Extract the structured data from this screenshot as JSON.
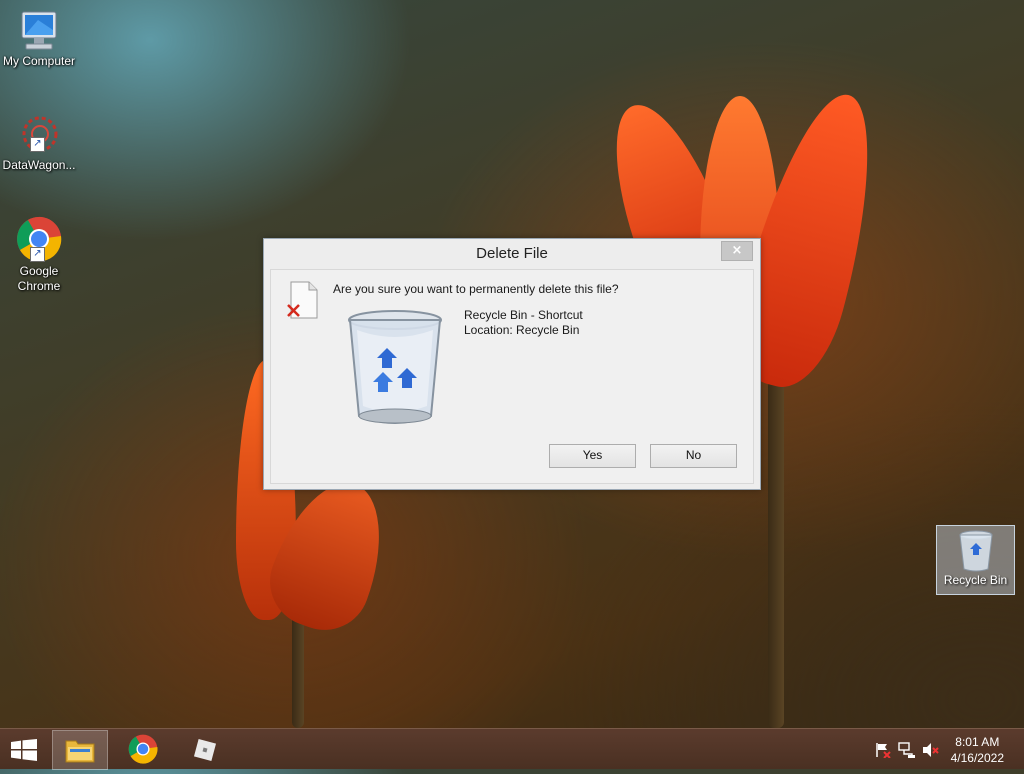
{
  "desktop": {
    "icons": [
      {
        "label": "My Computer"
      },
      {
        "label": "DataWagon..."
      },
      {
        "label": "Google Chrome"
      }
    ],
    "recycle_bin_label": "Recycle Bin"
  },
  "dialog": {
    "title": "Delete File",
    "close_symbol": "×",
    "question": "Are you sure you want to permanently delete this file?",
    "file_name": "Recycle Bin - Shortcut",
    "location": "Location: Recycle Bin",
    "yes_label": "Yes",
    "no_label": "No"
  },
  "taskbar": {
    "items": [
      "start-button",
      "file-explorer",
      "google-chrome",
      "roblox"
    ],
    "clock_time": "8:01 AM",
    "clock_date": "4/16/2022"
  },
  "colors": {
    "accent": "#4a3022",
    "dialog_bg": "#f0f0f0"
  }
}
